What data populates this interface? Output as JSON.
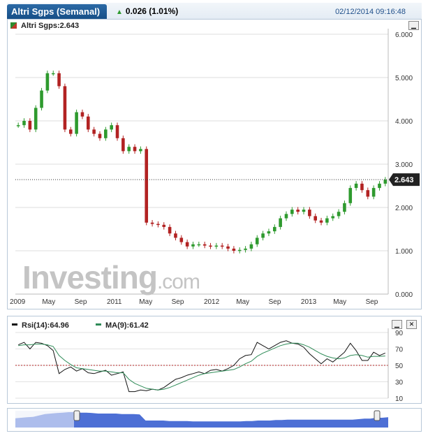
{
  "header": {
    "title": "Altri Sgps (Semanal)",
    "change": "0.026 (1.01%)",
    "timestamp": "02/12/2014 09:16:48"
  },
  "main_chart": {
    "symbol_label": "Altri Sgps:2.643",
    "last_price_label": "2.643",
    "watermark_main": "Investing",
    "watermark_suffix": ".com",
    "minimize_icon": "minimize-icon"
  },
  "rsi_panel": {
    "rsi_label": "Rsi(14):64.96",
    "ma_label": "MA(9):61.42",
    "minimize_icon": "minimize-icon",
    "close_icon": "close-icon"
  },
  "colors": {
    "up_candle": "#2e9a2e",
    "down_candle": "#b22222",
    "rsi_line": "#111111",
    "ma_line": "#2e8b57",
    "navigator_fill": "#3a5fd0",
    "title_bg": "#1f5c99"
  },
  "chart_data": [
    {
      "type": "line",
      "title": "Altri Sgps (Semanal)",
      "x_tick_labels": [
        "2009",
        "May",
        "Sep",
        "2011",
        "May",
        "Sep",
        "2012",
        "May",
        "Sep",
        "2013",
        "May",
        "Sep"
      ],
      "y_tick_labels": [
        "6.000",
        "5.000",
        "4.000",
        "3.000",
        "2.000",
        "1.000",
        "0.000"
      ],
      "ylim": [
        0,
        6
      ],
      "last_value": 2.643,
      "grid": true,
      "series": [
        {
          "name": "Altri Sgps",
          "values": [
            3.9,
            4.0,
            3.8,
            4.3,
            4.7,
            5.1,
            5.1,
            4.8,
            3.8,
            3.7,
            4.2,
            4.1,
            3.8,
            3.7,
            3.6,
            3.8,
            3.9,
            3.6,
            3.3,
            3.4,
            3.3,
            3.35,
            1.65,
            1.62,
            1.6,
            1.55,
            1.4,
            1.3,
            1.2,
            1.1,
            1.15,
            1.15,
            1.12,
            1.1,
            1.12,
            1.1,
            1.05,
            1.0,
            1.02,
            1.05,
            1.15,
            1.3,
            1.4,
            1.45,
            1.55,
            1.75,
            1.85,
            1.95,
            1.9,
            1.95,
            1.8,
            1.7,
            1.65,
            1.75,
            1.8,
            1.9,
            2.1,
            2.45,
            2.55,
            2.4,
            2.25,
            2.45,
            2.55,
            2.643
          ]
        }
      ]
    },
    {
      "type": "line",
      "title": "Rsi(14)",
      "y_tick_labels": [
        "90",
        "70",
        "50",
        "30",
        "10"
      ],
      "ylim": [
        10,
        90
      ],
      "series": [
        {
          "name": "Rsi(14)",
          "values": [
            75,
            78,
            70,
            78,
            77,
            74,
            68,
            40,
            45,
            48,
            43,
            46,
            41,
            40,
            42,
            44,
            38,
            40,
            42,
            18,
            18,
            20,
            19,
            21,
            20,
            23,
            28,
            33,
            35,
            38,
            40,
            42,
            40,
            44,
            45,
            43,
            46,
            50,
            58,
            62,
            63,
            78,
            74,
            70,
            74,
            78,
            80,
            77,
            76,
            72,
            64,
            58,
            52,
            58,
            54,
            60,
            66,
            77,
            68,
            56,
            56,
            66,
            62,
            64.96
          ]
        },
        {
          "name": "MA(9)",
          "values": [
            74,
            75,
            75,
            76,
            76,
            75,
            73,
            62,
            56,
            51,
            47,
            46,
            45,
            44,
            43,
            43,
            42,
            41,
            41,
            33,
            28,
            25,
            22,
            21,
            20,
            21,
            23,
            26,
            29,
            32,
            35,
            38,
            40,
            41,
            42,
            43,
            44,
            45,
            48,
            52,
            55,
            61,
            65,
            68,
            71,
            74,
            76,
            77,
            77,
            75,
            72,
            68,
            64,
            61,
            59,
            58,
            59,
            62,
            63,
            62,
            60,
            61,
            61,
            61.42
          ]
        }
      ]
    },
    {
      "type": "area",
      "title": "navigator",
      "series": [
        {
          "name": "navigator",
          "values": [
            20,
            21,
            22,
            23,
            26,
            29,
            30,
            31,
            32,
            33,
            33,
            32,
            32,
            31,
            30,
            30,
            30,
            30,
            29,
            29,
            29,
            28,
            15,
            15,
            15,
            15,
            14,
            14,
            14,
            14,
            13,
            13,
            13,
            13,
            13,
            13,
            13,
            13,
            13,
            14,
            14,
            15,
            15,
            15,
            16,
            16,
            17,
            17,
            17,
            17,
            17,
            17,
            17,
            17,
            17,
            17,
            17,
            17,
            18,
            19,
            19,
            21,
            21,
            22
          ]
        }
      ]
    }
  ]
}
